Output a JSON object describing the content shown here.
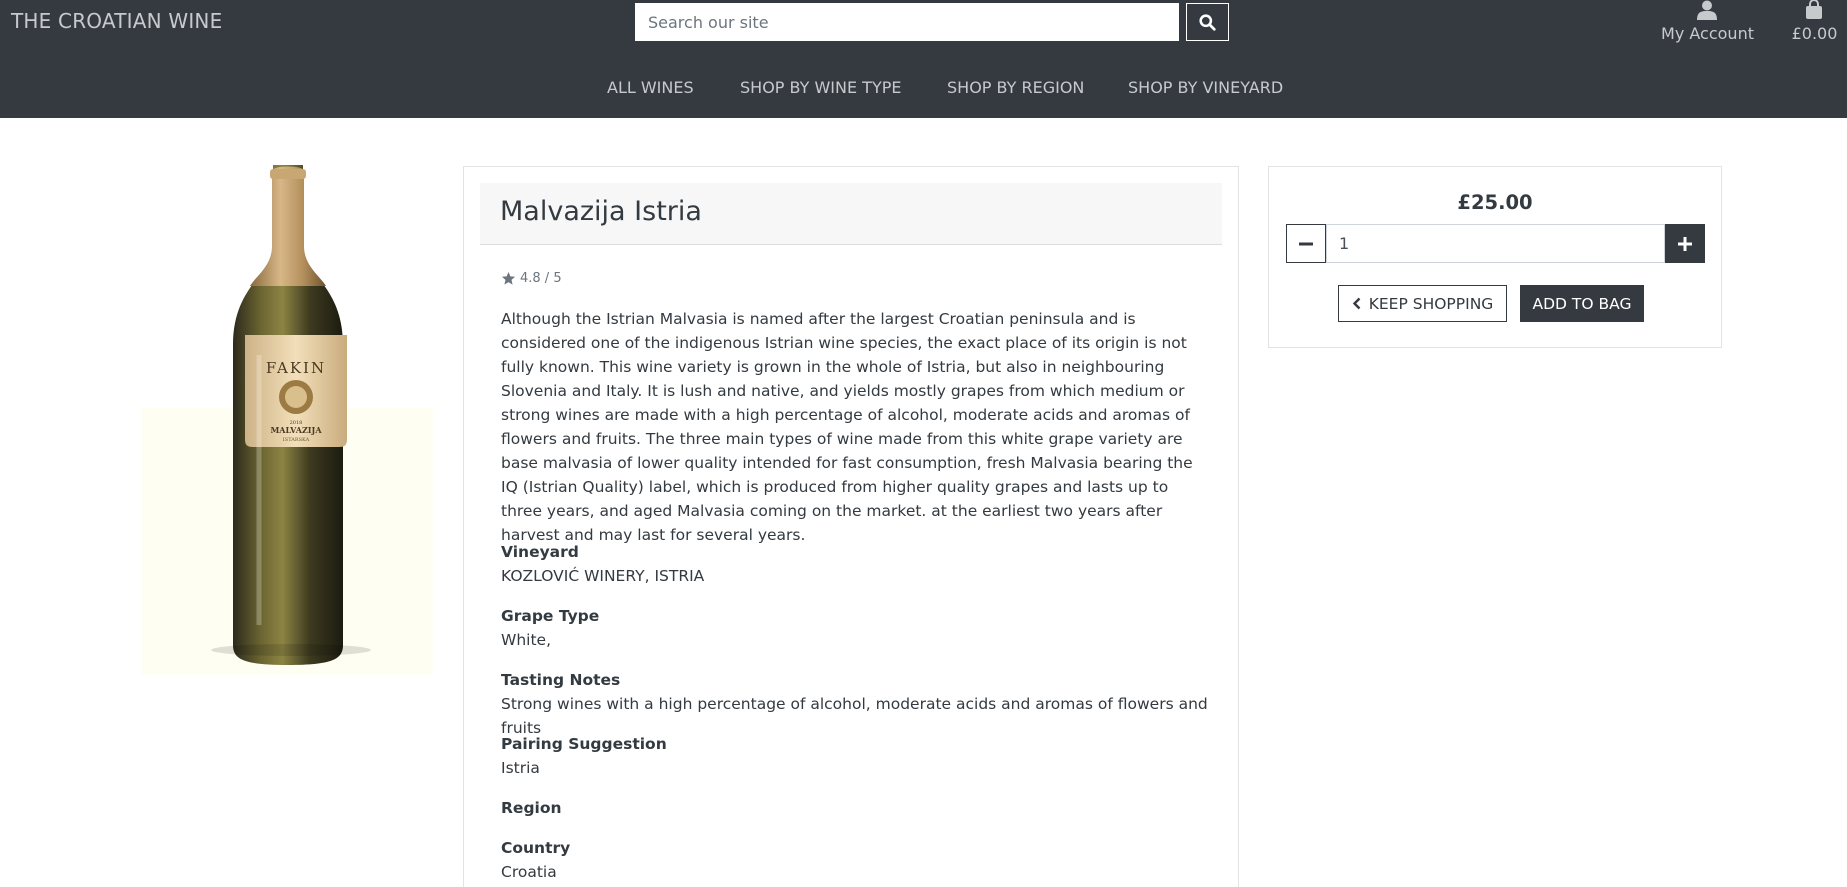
{
  "header": {
    "brand": "THE CROATIAN WINE",
    "search": {
      "placeholder": "Search our site",
      "value": ""
    },
    "account_label": "My Account",
    "bag_total": "£0.00"
  },
  "nav": {
    "items": [
      {
        "label": "ALL WINES"
      },
      {
        "label": "SHOP BY WINE TYPE"
      },
      {
        "label": "SHOP BY REGION"
      },
      {
        "label": "SHOP BY VINEYARD"
      }
    ]
  },
  "product": {
    "image_label": {
      "brand": "FAKIN",
      "year": "2018",
      "name": "MALVAZIJA",
      "region": "ISTARSKA"
    },
    "title": "Malvazija Istria",
    "rating": "4.8 / 5",
    "description": "Although the Istrian Malvasia is named after the largest Croatian peninsula and is considered one of the indigenous Istrian wine species, the exact place of its origin is not fully known. This wine variety is grown in the whole of Istria, but also in neighbouring Slovenia and Italy. It is lush and native, and yields mostly grapes from which medium or strong wines are made with a high percentage of alcohol, moderate acids and aromas of flowers and fruits. The three main types of wine made from this white grape variety are base malvasia of lower quality intended for fast consumption, fresh Malvasia bearing the IQ (Istrian Quality) label, which is produced from higher quality grapes and lasts up to three years, and aged Malvasia coming on the market. at the earliest two years after harvest and may last for several years.",
    "fields": [
      {
        "label": "Vineyard",
        "value": "KOZLOVIĆ WINERY, ISTRIA"
      },
      {
        "label": "Grape Type",
        "value": "White,"
      },
      {
        "label": "Tasting Notes",
        "value": "Strong wines with a high percentage of alcohol, moderate acids and aromas of flowers and fruits"
      },
      {
        "label": "Pairing Suggestion",
        "value": "Istria"
      },
      {
        "label": "Region",
        "value": ""
      },
      {
        "label": "Country",
        "value": "Croatia"
      }
    ]
  },
  "purchase": {
    "price": "£25.00",
    "quantity": "1",
    "keep_shopping_label": "KEEP SHOPPING",
    "add_to_bag_label": "ADD TO BAG"
  },
  "colors": {
    "header_bg": "#343a40",
    "header_text": "#c7cacd",
    "title_bar_bg": "#f7f7f7",
    "button_dark": "#343a40"
  },
  "icons": [
    "search-icon",
    "user-icon",
    "shopping-bag-icon",
    "star-icon",
    "minus-icon",
    "plus-icon",
    "chevron-left-icon"
  ]
}
